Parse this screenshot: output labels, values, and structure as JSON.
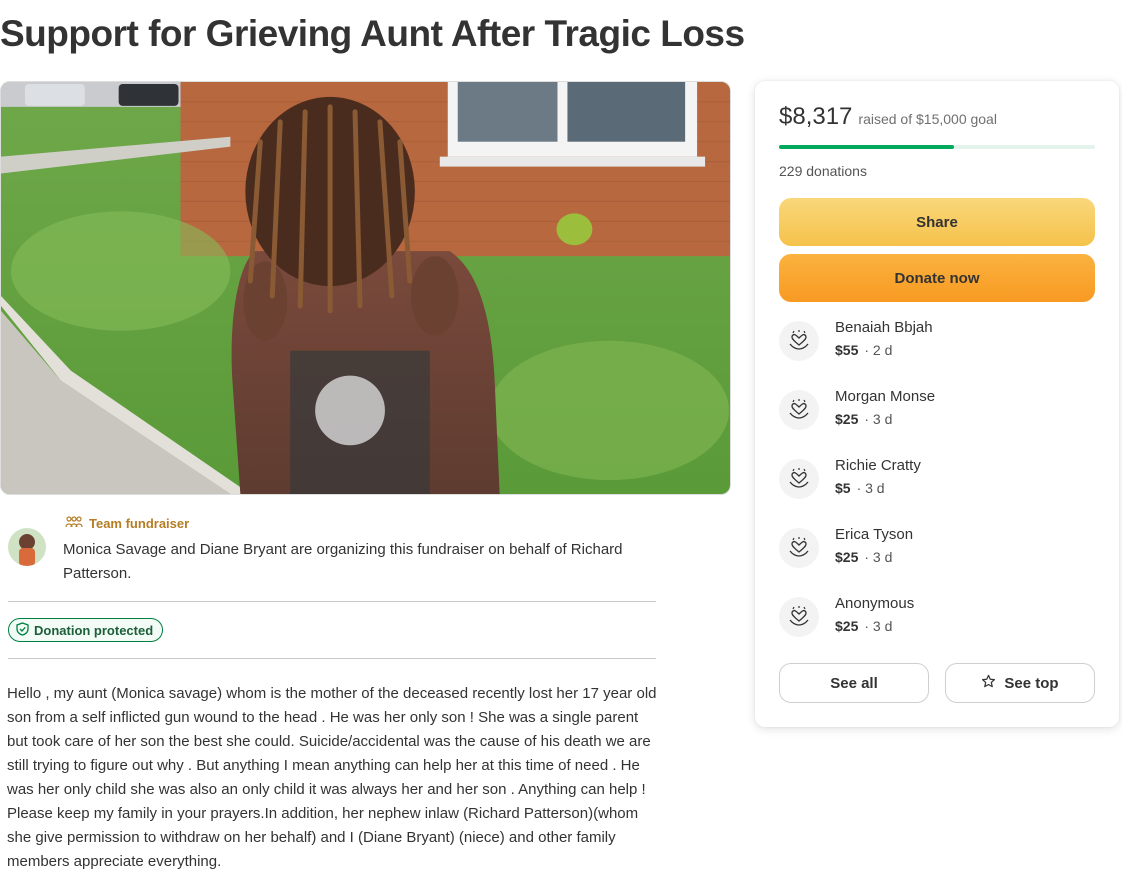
{
  "page": {
    "title": "Support for Grieving Aunt After Tragic Loss"
  },
  "organizer": {
    "team_label": "Team fundraiser",
    "text": "Monica Savage and Diane Bryant are organizing this fundraiser on behalf of Richard Patterson."
  },
  "badge": {
    "protected_label": "Donation protected"
  },
  "story": {
    "text": "Hello , my aunt (Monica savage) whom is the mother of the deceased recently lost her 17 year old son from a self inflicted gun wound to the head . He was her only son ! She was a single parent but took care of her son the best she could. Suicide/accidental was the cause of his death we are still trying to figure out why . But anything I mean anything can help her at this time of need . He was her only child she was also an only child it was always her and her son . Anything can help ! Please keep my family in your prayers.In addition, her nephew inlaw (Richard Patterson)(whom she give permission to withdraw on her behalf) and I (Diane Bryant) (niece) and other family members appreciate everything."
  },
  "card": {
    "raised": "$8,317",
    "goal_text": "raised of $15,000 goal",
    "progress_fraction": 0.5545,
    "donations": "229 donations",
    "share_label": "Share",
    "donate_label": "Donate now",
    "donors": [
      {
        "name": "Benaiah Bbjah",
        "amount": "$55",
        "time": "· 2 d"
      },
      {
        "name": "Morgan Monse",
        "amount": "$25",
        "time": "· 3 d"
      },
      {
        "name": "Richie Cratty",
        "amount": "$5",
        "time": "· 3 d"
      },
      {
        "name": "Erica Tyson",
        "amount": "$25",
        "time": "· 3 d"
      },
      {
        "name": "Anonymous",
        "amount": "$25",
        "time": "· 3 d"
      }
    ],
    "see_all_label": "See all",
    "see_top_label": "See top"
  },
  "colors": {
    "brand_green": "#02a95c",
    "share_yellow": "#f5c24a",
    "donate_orange": "#f79a22",
    "team_gold": "#b57d24"
  },
  "icons": {
    "team": "people-icon",
    "protected": "shield-icon",
    "donor": "heart-hands-icon",
    "see_top": "star-icon"
  }
}
